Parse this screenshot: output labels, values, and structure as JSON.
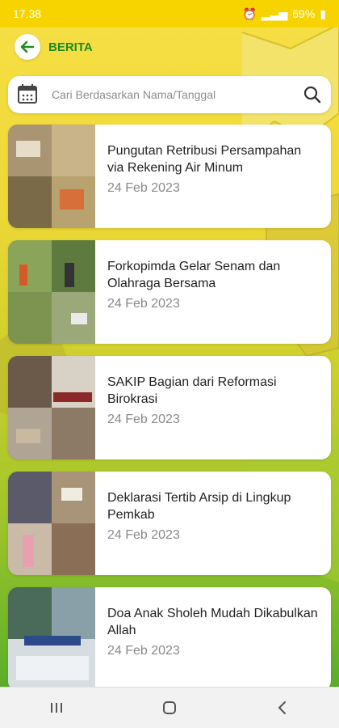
{
  "status_bar": {
    "time": "17.38",
    "battery": "69%"
  },
  "app_bar": {
    "title": "BERITA"
  },
  "search": {
    "placeholder": "Cari Berdasarkan Nama/Tanggal"
  },
  "news": [
    {
      "title": "Pungutan Retribusi Persampahan via Rekening Air Minum",
      "date": "24 Feb 2023"
    },
    {
      "title": "Forkopimda Gelar Senam dan Olahraga Bersama",
      "date": "24 Feb 2023"
    },
    {
      "title": "SAKIP Bagian dari Reformasi Birokrasi",
      "date": "24 Feb 2023"
    },
    {
      "title": "Deklarasi Tertib Arsip di Lingkup Pemkab",
      "date": "24 Feb 2023"
    },
    {
      "title": "Doa Anak Sholeh Mudah Dikabulkan Allah",
      "date": "24 Feb 2023"
    }
  ],
  "nav_buttons": [
    "recents-icon",
    "home-icon",
    "back-nav-icon"
  ]
}
